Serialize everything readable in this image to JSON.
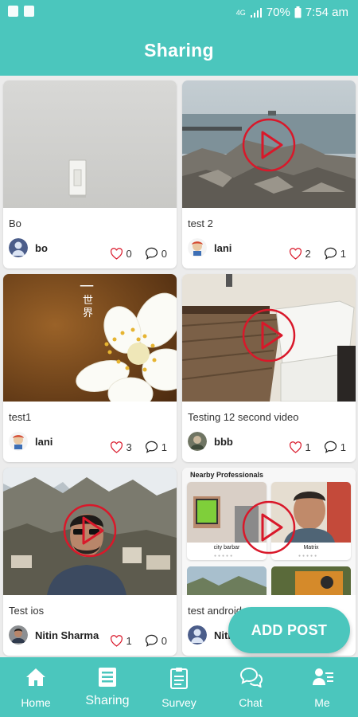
{
  "status_bar": {
    "signal": "4G",
    "battery": "70%",
    "time": "7:54 am"
  },
  "header": {
    "title": "Sharing"
  },
  "posts": [
    {
      "caption": "Bo",
      "author": "bo",
      "likes": "0",
      "comments": "0",
      "is_video": false
    },
    {
      "caption": "test 2",
      "author": "lani",
      "likes": "2",
      "comments": "1",
      "is_video": true
    },
    {
      "caption": "test1",
      "author": "lani",
      "likes": "3",
      "comments": "1",
      "is_video": false
    },
    {
      "caption": "Testing 12 second video",
      "author": "bbb",
      "likes": "1",
      "comments": "1",
      "is_video": true
    },
    {
      "caption": "Test ios",
      "author": "Nitin Sharma",
      "likes": "1",
      "comments": "0",
      "is_video": true
    },
    {
      "caption": "test android",
      "author": "Niti",
      "likes": "",
      "comments": "",
      "is_video": true,
      "thumbnail": {
        "heading": "Nearby Professionals",
        "items": [
          "city barbar",
          "Matrix"
        ]
      }
    }
  ],
  "media_text": {
    "calligraphy_top": "一",
    "calligraphy_bottom": "世\n界"
  },
  "fab": {
    "label": "ADD POST"
  },
  "nav": [
    {
      "label": "Home",
      "icon": "home-icon"
    },
    {
      "label": "Sharing",
      "icon": "list-icon"
    },
    {
      "label": "Survey",
      "icon": "clipboard-icon"
    },
    {
      "label": "Chat",
      "icon": "chat-icon"
    },
    {
      "label": "Me",
      "icon": "profile-icon"
    }
  ],
  "colors": {
    "primary": "#4bc6bd",
    "play_ring": "#d9182a"
  }
}
